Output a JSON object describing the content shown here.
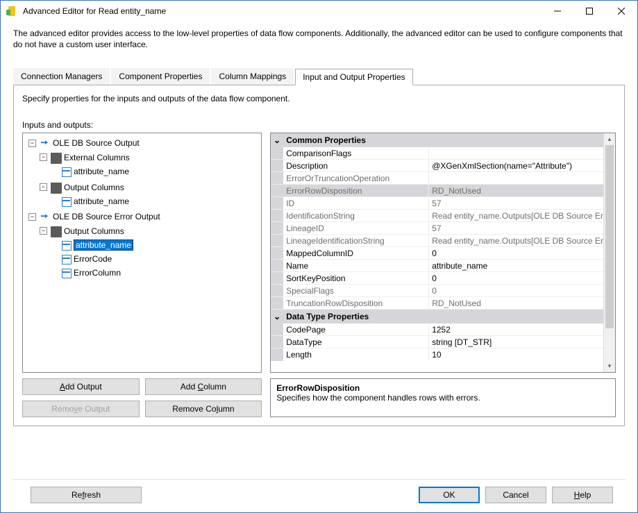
{
  "window": {
    "title": "Advanced Editor for Read entity_name"
  },
  "description": "The advanced editor provides access to the low-level properties of data flow components. Additionally, the advanced editor can be used to configure components that do not have a custom user interface.",
  "tabs": [
    {
      "label": "Connection Managers"
    },
    {
      "label": "Component Properties"
    },
    {
      "label": "Column Mappings"
    },
    {
      "label": "Input and Output Properties"
    }
  ],
  "active_tab_index": 3,
  "tabpane": {
    "subdesc": "Specify properties for the inputs and outputs of the data flow component.",
    "inout_label": "Inputs and outputs:"
  },
  "tree": {
    "n0": {
      "label": "OLE DB Source Output"
    },
    "n1": {
      "label": "External Columns"
    },
    "n2": {
      "label": "attribute_name"
    },
    "n3": {
      "label": "Output Columns"
    },
    "n4": {
      "label": "attribute_name"
    },
    "n5": {
      "label": "OLE DB Source Error Output"
    },
    "n6": {
      "label": "Output Columns"
    },
    "n7": {
      "label": "attribute_name"
    },
    "n8": {
      "label": "ErrorCode"
    },
    "n9": {
      "label": "ErrorColumn"
    }
  },
  "buttons": {
    "add_output": "Add Output",
    "add_column": "Add Column",
    "remove_output": "Remove Output",
    "remove_column": "Remove Column",
    "refresh": "Refresh",
    "ok": "OK",
    "cancel": "Cancel",
    "help": "Help"
  },
  "propgrid": {
    "cat_common": "Common Properties",
    "cat_dtype": "Data Type Properties",
    "rows": {
      "ComparisonFlags": {
        "name": "ComparisonFlags",
        "value": ""
      },
      "Description": {
        "name": "Description",
        "value": "@XGenXmlSection(name=\"Attribute\")"
      },
      "ErrorOrTruncationOperation": {
        "name": "ErrorOrTruncationOperation",
        "value": ""
      },
      "ErrorRowDisposition": {
        "name": "ErrorRowDisposition",
        "value": "RD_NotUsed"
      },
      "ID": {
        "name": "ID",
        "value": "57"
      },
      "IdentificationString": {
        "name": "IdentificationString",
        "value": "Read entity_name.Outputs[OLE DB Source Er"
      },
      "LineageID": {
        "name": "LineageID",
        "value": "57"
      },
      "LineageIdentificationString": {
        "name": "LineageIdentificationString",
        "value": "Read entity_name.Outputs[OLE DB Source Er"
      },
      "MappedColumnID": {
        "name": "MappedColumnID",
        "value": "0"
      },
      "Name": {
        "name": "Name",
        "value": "attribute_name"
      },
      "SortKeyPosition": {
        "name": "SortKeyPosition",
        "value": "0"
      },
      "SpecialFlags": {
        "name": "SpecialFlags",
        "value": "0"
      },
      "TruncationRowDisposition": {
        "name": "TruncationRowDisposition",
        "value": "RD_NotUsed"
      },
      "CodePage": {
        "name": "CodePage",
        "value": "1252"
      },
      "DataType": {
        "name": "DataType",
        "value": "string [DT_STR]"
      },
      "Length": {
        "name": "Length",
        "value": "10"
      }
    }
  },
  "helpbox": {
    "title": "ErrorRowDisposition",
    "text": "Specifies how the component handles rows with errors."
  }
}
